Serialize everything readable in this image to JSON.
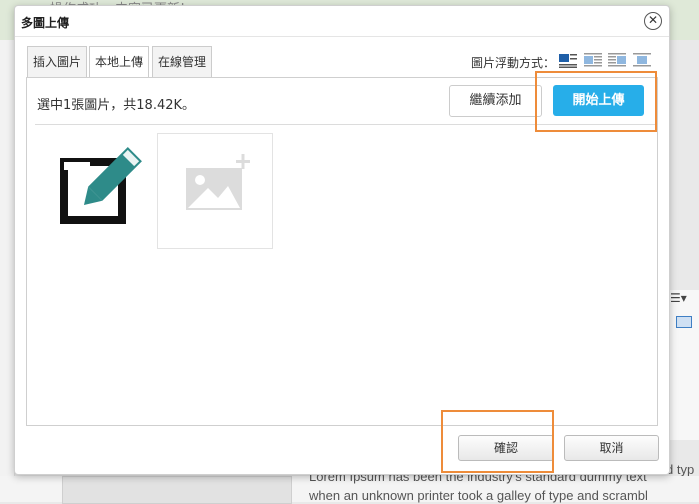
{
  "background": {
    "top_text": "操作成功，内容已更新!",
    "lorem_lines": [
      "Lorem Ipsum has been the industry's standard dummy text",
      "when an unknown printer took a galley of type and scrambl"
    ],
    "lorem_right": "d typ"
  },
  "dialog": {
    "title": "多圖上傳",
    "close_glyph": "✕",
    "tabs": [
      {
        "label": "插入圖片",
        "active": false
      },
      {
        "label": "本地上傳",
        "active": true
      },
      {
        "label": "在線管理",
        "active": false
      }
    ],
    "float_label": "圖片浮動方式：",
    "float_options": [
      "float-none-icon",
      "float-left-icon",
      "float-right-icon",
      "float-center-icon"
    ],
    "status_text": "選中1張圖片，共18.42K。",
    "continue_label": "繼續添加",
    "start_label": "開始上傳",
    "ok_label": "確認",
    "cancel_label": "取消"
  },
  "colors": {
    "primary": "#27aee9",
    "highlight": "#ee8c3a",
    "edit_icon_teal": "#2e8b89"
  }
}
